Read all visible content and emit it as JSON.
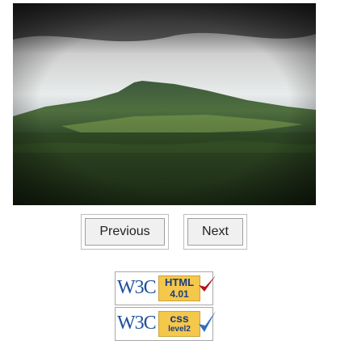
{
  "photo": {
    "alt": "Mountain landscape under cloudy sky"
  },
  "navigation": {
    "previous_label": "Previous",
    "next_label": "Next"
  },
  "badges": {
    "html": {
      "logo": "W3C",
      "line1": "HTML",
      "line2": "4.01",
      "check_color": "#b3131b"
    },
    "css": {
      "logo": "W3C",
      "line1": "css",
      "line2": "level2",
      "check_color": "#2f6fc3"
    }
  }
}
